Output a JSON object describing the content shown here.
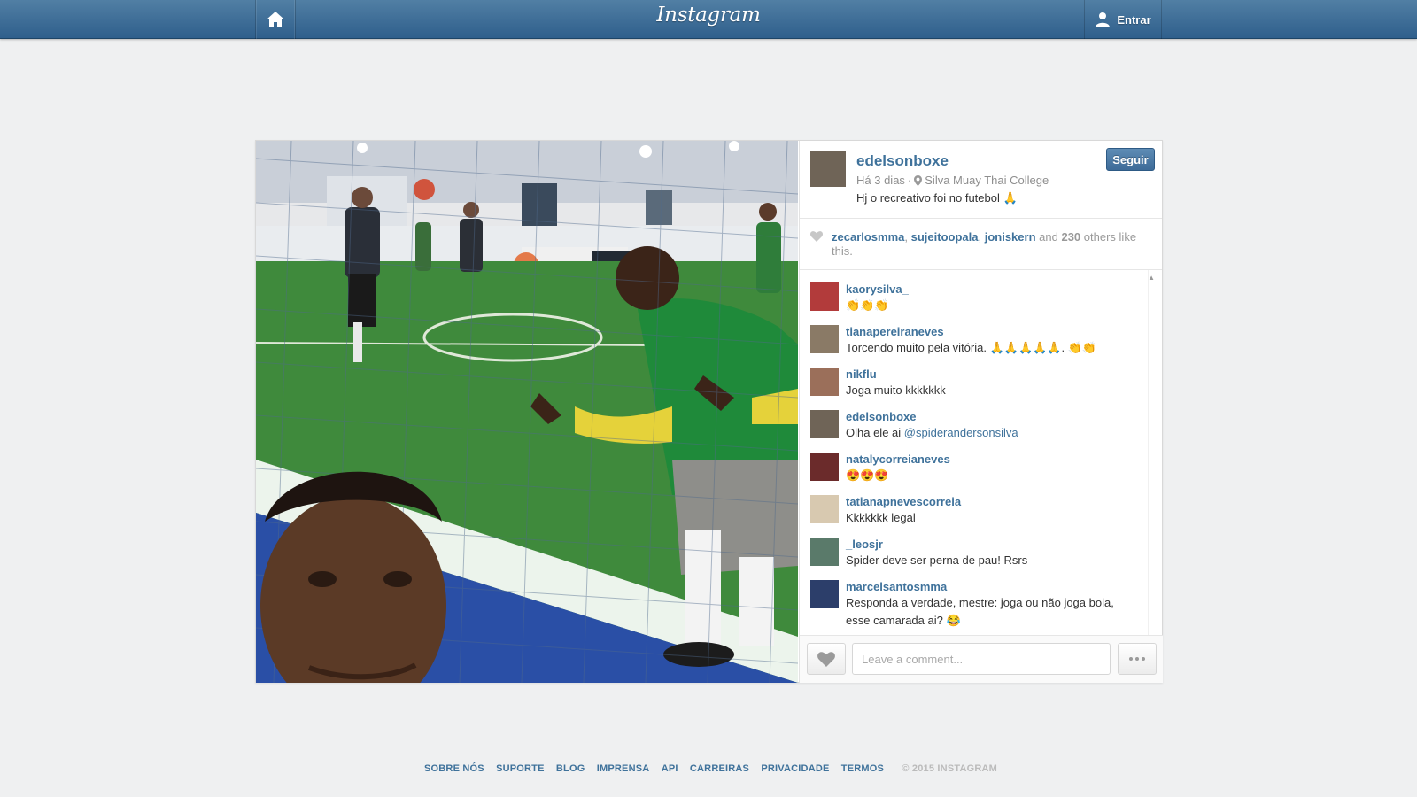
{
  "topbar": {
    "logo": "Instagram",
    "login_label": "Entrar"
  },
  "post": {
    "username": "edelsonboxe",
    "time": "Há 3 dias",
    "location": "Silva Muay Thai College",
    "caption": "Hj o recreativo foi no futebol 🙏",
    "follow_label": "Seguir",
    "likes": {
      "names": [
        "zecarlosmma",
        "sujeitoopala",
        "joniskern"
      ],
      "and": "and",
      "count": "230",
      "suffix": "others like this."
    }
  },
  "comments": [
    {
      "user": "kaorysilva_",
      "text": "👏👏👏",
      "avatar_color": "#b23b3b"
    },
    {
      "user": "tianapereiraneves",
      "text": "Torcendo muito pela vitória. 🙏🙏🙏🙏🙏. 👏👏",
      "avatar_color": "#8a7a66"
    },
    {
      "user": "nikflu",
      "text": "Joga muito kkkkkkk",
      "avatar_color": "#9b6f5a"
    },
    {
      "user": "edelsonboxe",
      "text": "Olha ele ai",
      "mention": "@spiderandersonsilva",
      "avatar_color": "#6f6457"
    },
    {
      "user": "natalycorreianeves",
      "text": "😍😍😍",
      "avatar_color": "#6b2b2b"
    },
    {
      "user": "tatianapnevescorreia",
      "text": "Kkkkkkk legal",
      "avatar_color": "#d8c9b0"
    },
    {
      "user": "_leosjr",
      "text": "Spider deve ser perna de pau! Rsrs",
      "avatar_color": "#5a7a6a"
    },
    {
      "user": "marcelsantosmma",
      "text": "Responda a verdade, mestre: joga ou não joga bola, esse camarada ai? 😂",
      "avatar_color": "#2c3e6a"
    }
  ],
  "comment_box": {
    "placeholder": "Leave a comment..."
  },
  "footer": {
    "links": [
      "SOBRE NÓS",
      "SUPORTE",
      "BLOG",
      "IMPRENSA",
      "API",
      "CARREIRAS",
      "PRIVACIDADE",
      "TERMOS"
    ],
    "copyright": "© 2015 INSTAGRAM"
  },
  "colors": {
    "brand_blue": "#3f729b",
    "topbar": "#2f5f8c"
  }
}
